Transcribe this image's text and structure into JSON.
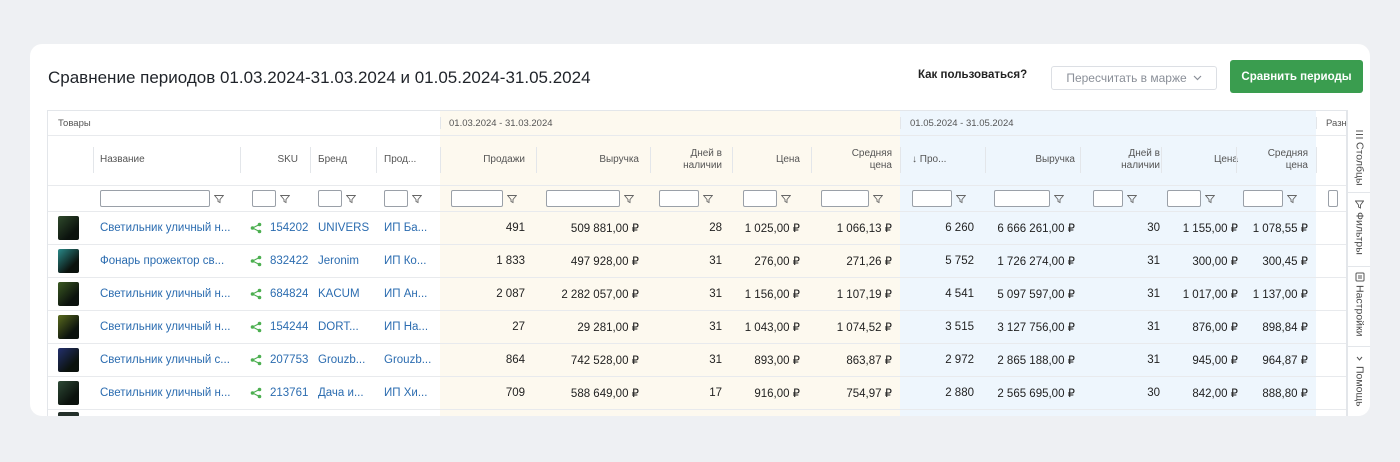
{
  "header": {
    "title": "Сравнение периодов 01.03.2024-31.03.2024 и 01.05.2024-31.05.2024",
    "howto": "Как пользоваться?",
    "recalc": "Пересчитать в марже",
    "compare": "Сравнить периоды"
  },
  "groups": {
    "products": "Товары",
    "period1": "01.03.2024 - 31.03.2024",
    "period2": "01.05.2024 - 31.05.2024",
    "diff": "Разн"
  },
  "columns": {
    "name": "Название",
    "sku": "SKU",
    "brand": "Бренд",
    "seller": "Прод...",
    "sales1": "Продажи",
    "rev1": "Выручка",
    "days1": [
      "Дней в",
      "наличии"
    ],
    "price1": "Цена",
    "avg1": [
      "Средняя",
      "цена"
    ],
    "sales2": "↓ Про...",
    "rev2": "Выручка",
    "days2": [
      "Дней в",
      "наличии"
    ],
    "price2": "Цена",
    "avg2": [
      "Средняя",
      "цена"
    ]
  },
  "side": {
    "columns": "Столбцы",
    "filters": "Фильтры",
    "settings": "Настройки",
    "help": "Помощь"
  },
  "rows": [
    {
      "name": "Светильник уличный н...",
      "sku": "154202",
      "brand": "UNIVERS",
      "seller": "ИП Ба...",
      "sales1": "491",
      "rev1": "509 881,00 ₽",
      "days1": "28",
      "price1": "1 025,00 ₽",
      "avg1": "1 066,13 ₽",
      "sales2": "6 260",
      "rev2": "6 666 261,00 ₽",
      "days2": "30",
      "price2": "1 155,00 ₽",
      "avg2": "1 078,55 ₽",
      "thumb": "#2f4a2c"
    },
    {
      "name": "Фонарь прожектор св...",
      "sku": "832422",
      "brand": "Jeronim",
      "seller": "ИП Ко...",
      "sales1": "1 833",
      "rev1": "497 928,00 ₽",
      "days1": "31",
      "price1": "276,00 ₽",
      "avg1": "271,26 ₽",
      "sales2": "5 752",
      "rev2": "1 726 274,00 ₽",
      "days2": "31",
      "price2": "300,00 ₽",
      "avg2": "300,45 ₽",
      "thumb": "#2a8a8a"
    },
    {
      "name": "Светильник уличный н...",
      "sku": "684824",
      "brand": "KACUM",
      "seller": "ИП Ан...",
      "sales1": "2 087",
      "rev1": "2 282 057,00 ₽",
      "days1": "31",
      "price1": "1 156,00 ₽",
      "avg1": "1 107,19 ₽",
      "sales2": "4 541",
      "rev2": "5 097 597,00 ₽",
      "days2": "31",
      "price2": "1 017,00 ₽",
      "avg2": "1 137,00 ₽",
      "thumb": "#3b5a22"
    },
    {
      "name": "Светильник уличный н...",
      "sku": "154244",
      "brand": "DORT...",
      "seller": "ИП На...",
      "sales1": "27",
      "rev1": "29 281,00 ₽",
      "days1": "31",
      "price1": "1 043,00 ₽",
      "avg1": "1 074,52 ₽",
      "sales2": "3 515",
      "rev2": "3 127 756,00 ₽",
      "days2": "31",
      "price2": "876,00 ₽",
      "avg2": "898,84 ₽",
      "thumb": "#5a6b1e"
    },
    {
      "name": "Светильник уличный с...",
      "sku": "207753",
      "brand": "Grouzb...",
      "seller": "Grouzb...",
      "sales1": "864",
      "rev1": "742 528,00 ₽",
      "days1": "31",
      "price1": "893,00 ₽",
      "avg1": "863,87 ₽",
      "sales2": "2 972",
      "rev2": "2 865 188,00 ₽",
      "days2": "31",
      "price2": "945,00 ₽",
      "avg2": "964,87 ₽",
      "thumb": "#23306e"
    },
    {
      "name": "Светильник уличный н...",
      "sku": "213761",
      "brand": "Дача и...",
      "seller": "ИП Хи...",
      "sales1": "709",
      "rev1": "588 649,00 ₽",
      "days1": "17",
      "price1": "916,00 ₽",
      "avg1": "754,97 ₽",
      "sales2": "2 880",
      "rev2": "2 565 695,00 ₽",
      "days2": "30",
      "price2": "842,00 ₽",
      "avg2": "888,80 ₽",
      "thumb": "#2e4a36"
    }
  ],
  "colors": {
    "accent": "#3a9d4f",
    "link": "#2b6cb0",
    "period1_bg": "#fdf9ef",
    "period2_bg": "#eef6fd",
    "share": "#4caf50"
  }
}
